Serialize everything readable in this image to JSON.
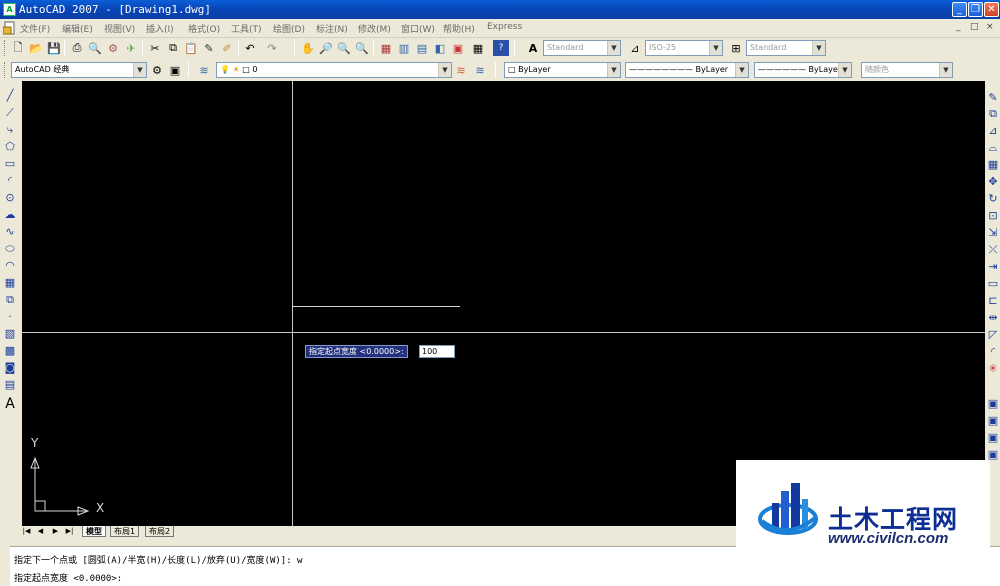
{
  "window": {
    "title": "AutoCAD 2007 - [Drawing1.dwg]",
    "app_icon": "A",
    "controls": [
      "minimize-icon",
      "restore-icon",
      "close-icon"
    ],
    "mdi_controls": [
      "_",
      "□",
      "×"
    ]
  },
  "menubar": {
    "items": [
      "文件(F)",
      "编辑(E)",
      "视图(V)",
      "插入(I)",
      "格式(O)",
      "工具(T)",
      "绘图(D)",
      "标注(N)",
      "修改(M)",
      "窗口(W)",
      "帮助(H)",
      "Express"
    ]
  },
  "standard_toolbar": {
    "text_style": "Standard",
    "dim_style": "ISO-25",
    "table_style": "Standard"
  },
  "workspace": {
    "value": "AutoCAD 经典"
  },
  "layers": {
    "current": "0"
  },
  "properties": {
    "color": "ByLayer",
    "linetype": "ByLayer",
    "lineweight": "ByLayer",
    "plotstyle": "随颜色"
  },
  "drawing": {
    "background": "#000000",
    "prompt_label": "指定起点宽度 <0.0000>:",
    "prompt_value": "100",
    "ucs_y": "Y",
    "ucs_x": "X"
  },
  "layout_tabs": {
    "nav": [
      "|◀",
      "◀",
      "▶",
      "▶|"
    ],
    "tabs": [
      "模型",
      "布局1",
      "布局2"
    ],
    "active": "模型"
  },
  "command_window": {
    "line1": "指定下一个点或 [圆弧(A)/半宽(H)/长度(L)/放弃(U)/宽度(W)]: w",
    "line2": "指定起点宽度 <0.0000>:"
  },
  "watermark": {
    "cn": "土木工程网",
    "url": "www.civilcn.com"
  },
  "colors": {
    "title_bar": "#0a5fd8",
    "drawing_bg": "#000000",
    "prompt_bg": "#23327d",
    "watermark_text": "#0c2e92"
  }
}
